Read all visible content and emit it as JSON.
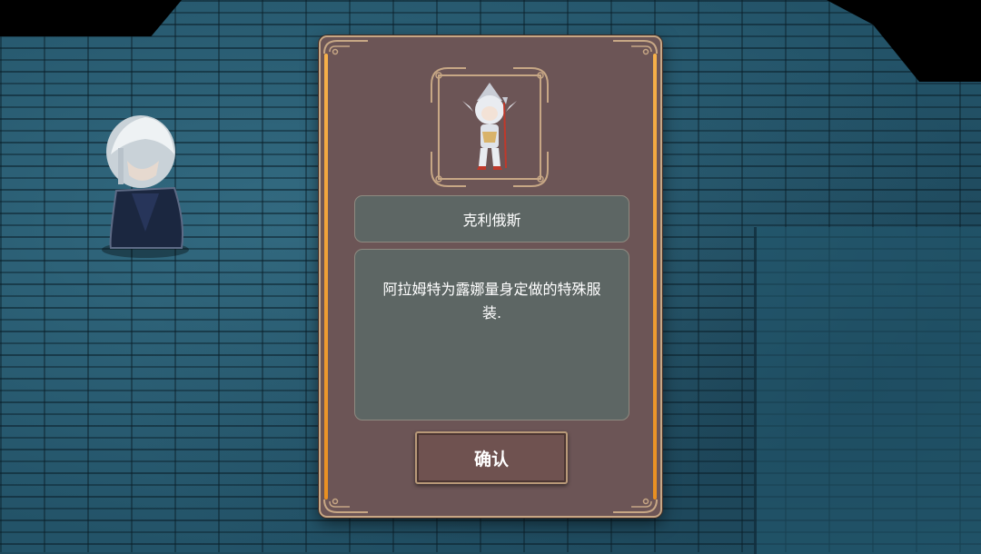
{
  "item": {
    "name": "克利俄斯",
    "description": "阿拉姆特为露娜量身定做的特殊服装."
  },
  "dialog": {
    "confirm_label": "确认"
  },
  "colors": {
    "panel": "#6c5556",
    "panel_border": "#c7a785",
    "accent_rail": "#f0a23a",
    "text_box": "#5d6664",
    "floor": "#235368"
  },
  "icons": {
    "portrait": "character-costume-portrait",
    "corner": "ornate-corner-flourish"
  }
}
